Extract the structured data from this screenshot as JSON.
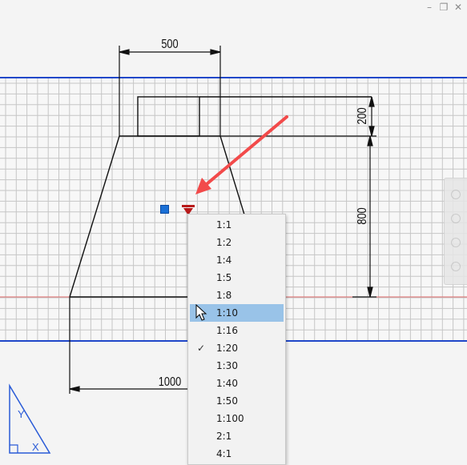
{
  "window_controls": {
    "minimize_glyph": "–",
    "restore_glyph": "❐",
    "close_glyph": "✕"
  },
  "drawing": {
    "dimensions": {
      "top_width": "500",
      "small_height": "200",
      "tall_height": "800",
      "bottom_width": "1000"
    },
    "colors": {
      "grid": "#c6c6c6",
      "band_border": "#1f47c9",
      "dimension_line": "#111111",
      "axis_red": "#e06a6a",
      "arrow_red": "#f24a4a",
      "handle_blue": "#1b70d6",
      "handle_red": "#b81a1a"
    }
  },
  "scale_menu": {
    "items": [
      {
        "label": "1:1",
        "checked": false,
        "selected": false
      },
      {
        "label": "1:2",
        "checked": false,
        "selected": false
      },
      {
        "label": "1:4",
        "checked": false,
        "selected": false
      },
      {
        "label": "1:5",
        "checked": false,
        "selected": false
      },
      {
        "label": "1:8",
        "checked": false,
        "selected": false
      },
      {
        "label": "1:10",
        "checked": false,
        "selected": true
      },
      {
        "label": "1:16",
        "checked": false,
        "selected": false
      },
      {
        "label": "1:20",
        "checked": true,
        "selected": false
      },
      {
        "label": "1:30",
        "checked": false,
        "selected": false
      },
      {
        "label": "1:40",
        "checked": false,
        "selected": false
      },
      {
        "label": "1:50",
        "checked": false,
        "selected": false
      },
      {
        "label": "1:100",
        "checked": false,
        "selected": false
      },
      {
        "label": "2:1",
        "checked": false,
        "selected": false
      },
      {
        "label": "4:1",
        "checked": false,
        "selected": false
      }
    ],
    "check_glyph": "✓"
  },
  "ucs_icon": {
    "x_label": "X",
    "y_label": "Y"
  }
}
